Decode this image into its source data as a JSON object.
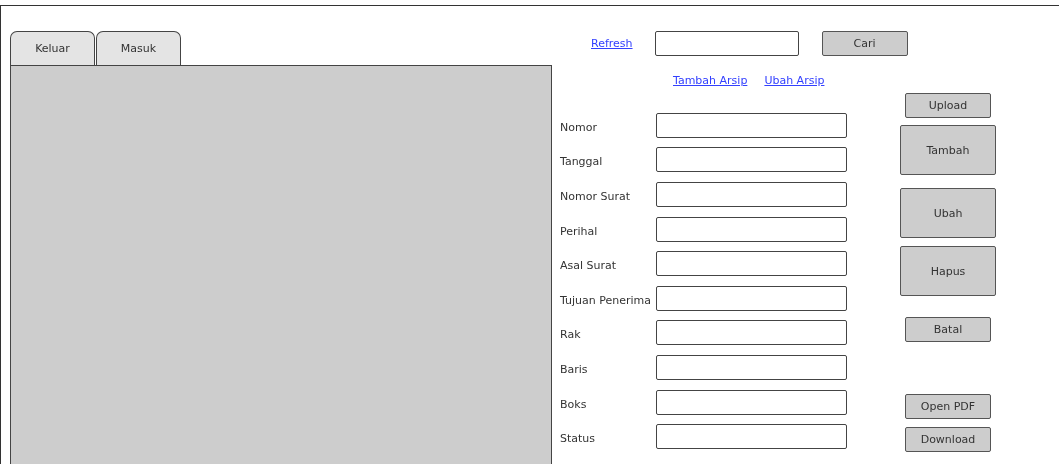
{
  "tabs": [
    {
      "label": "Keluar"
    },
    {
      "label": "Masuk"
    }
  ],
  "toolbar": {
    "refresh_link": "Refresh",
    "search_button": "Cari"
  },
  "links": [
    "Tambah Arsip",
    "Ubah Arsip"
  ],
  "form_fields": [
    {
      "label": "Nomor"
    },
    {
      "label": "Tanggal"
    },
    {
      "label": "Nomor Surat"
    },
    {
      "label": "Perihal"
    },
    {
      "label": "Asal Surat"
    },
    {
      "label": "Tujuan Penerima"
    },
    {
      "label": "Rak"
    },
    {
      "label": "Baris"
    },
    {
      "label": "Boks"
    },
    {
      "label": "Status"
    }
  ],
  "buttons": [
    {
      "label": "Upload",
      "kind": "small"
    },
    {
      "label": "Tambah",
      "kind": "large"
    },
    {
      "label": "Ubah",
      "kind": "large"
    },
    {
      "label": "Hapus",
      "kind": "large"
    },
    {
      "label": "Batal",
      "kind": "small"
    },
    {
      "label": "Open PDF",
      "kind": "small"
    },
    {
      "label": "Download",
      "kind": "small"
    }
  ]
}
